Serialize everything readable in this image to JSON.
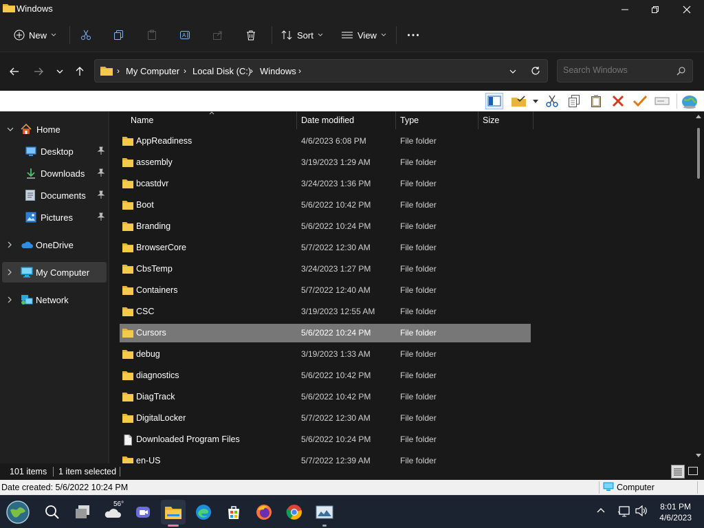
{
  "window": {
    "title": "Windows",
    "accent": "#e8b53b"
  },
  "commandbar": {
    "new_label": "New",
    "sort_label": "Sort",
    "view_label": "View",
    "more_label": "…"
  },
  "address": {
    "crumbs": [
      "My Computer",
      "Local Disk (C:)",
      "Windows"
    ],
    "search_placeholder": "Search Windows"
  },
  "sidebar": {
    "items": [
      {
        "label": "Home",
        "icon": "home-icon"
      },
      {
        "label": "Desktop",
        "icon": "desktop-icon",
        "pinned": true
      },
      {
        "label": "Downloads",
        "icon": "download-icon",
        "pinned": true
      },
      {
        "label": "Documents",
        "icon": "documents-icon",
        "pinned": true
      },
      {
        "label": "Pictures",
        "icon": "pictures-icon",
        "pinned": true
      },
      {
        "label": "OneDrive",
        "icon": "cloud-icon"
      },
      {
        "label": "My Computer",
        "icon": "computer-icon",
        "selected": true
      },
      {
        "label": "Network",
        "icon": "network-icon"
      }
    ]
  },
  "list": {
    "columns": [
      "Name",
      "Date modified",
      "Type",
      "Size"
    ],
    "rows": [
      {
        "name": "AppReadiness",
        "date": "4/6/2023 6:08 PM",
        "type": "File folder",
        "kind": "folder"
      },
      {
        "name": "assembly",
        "date": "3/19/2023 1:29 AM",
        "type": "File folder",
        "kind": "folder"
      },
      {
        "name": "bcastdvr",
        "date": "3/24/2023 1:36 PM",
        "type": "File folder",
        "kind": "folder"
      },
      {
        "name": "Boot",
        "date": "5/6/2022 10:42 PM",
        "type": "File folder",
        "kind": "folder"
      },
      {
        "name": "Branding",
        "date": "5/6/2022 10:24 PM",
        "type": "File folder",
        "kind": "folder"
      },
      {
        "name": "BrowserCore",
        "date": "5/7/2022 12:30 AM",
        "type": "File folder",
        "kind": "folder"
      },
      {
        "name": "CbsTemp",
        "date": "3/24/2023 1:27 PM",
        "type": "File folder",
        "kind": "folder"
      },
      {
        "name": "Containers",
        "date": "5/7/2022 12:40 AM",
        "type": "File folder",
        "kind": "folder"
      },
      {
        "name": "CSC",
        "date": "3/19/2023 12:55 AM",
        "type": "File folder",
        "kind": "folder"
      },
      {
        "name": "Cursors",
        "date": "5/6/2022 10:24 PM",
        "type": "File folder",
        "kind": "folder",
        "selected": true
      },
      {
        "name": "debug",
        "date": "3/19/2023 1:33 AM",
        "type": "File folder",
        "kind": "folder"
      },
      {
        "name": "diagnostics",
        "date": "5/6/2022 10:42 PM",
        "type": "File folder",
        "kind": "folder"
      },
      {
        "name": "DiagTrack",
        "date": "5/6/2022 10:42 PM",
        "type": "File folder",
        "kind": "folder"
      },
      {
        "name": "DigitalLocker",
        "date": "5/7/2022 12:30 AM",
        "type": "File folder",
        "kind": "folder"
      },
      {
        "name": "Downloaded Program Files",
        "date": "5/6/2022 10:24 PM",
        "type": "File folder",
        "kind": "file"
      },
      {
        "name": "en-US",
        "date": "5/7/2022 12:39 AM",
        "type": "File folder",
        "kind": "folder"
      }
    ]
  },
  "status": {
    "item_count": "101 items",
    "selection": "1 item selected",
    "date_created": "Date created: 5/6/2022 10:24 PM",
    "location": "Computer"
  },
  "taskbar": {
    "weather_temp": "56°",
    "time": "8:01 PM",
    "date": "4/6/2023"
  }
}
